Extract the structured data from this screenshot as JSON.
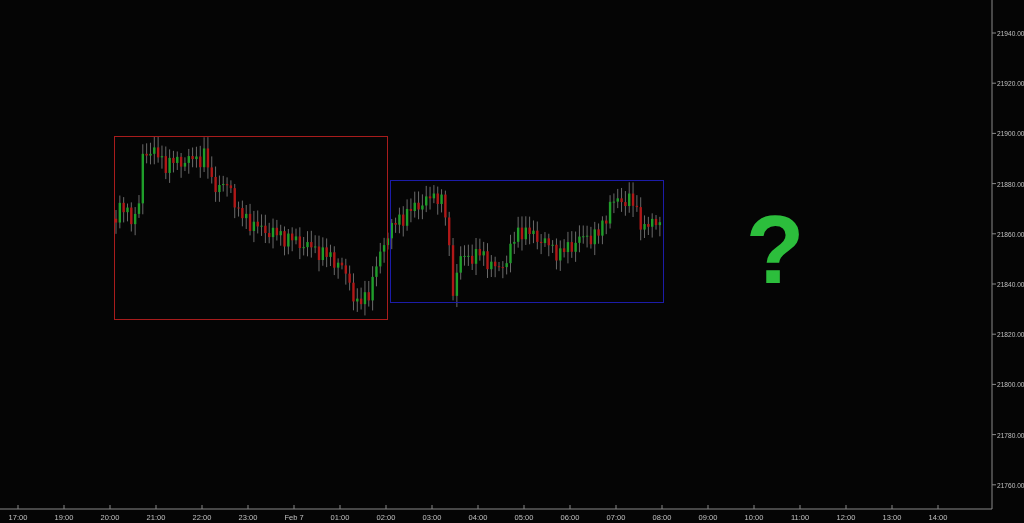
{
  "chart": {
    "y_axis_labels": [
      "21940.00",
      "21920.00",
      "21900.00",
      "21880.00",
      "21860.00",
      "21840.00",
      "21820.00",
      "21800.00",
      "21780.00",
      "21760.00"
    ],
    "x_axis_labels": [
      "17:00",
      "19:00",
      "20:00",
      "21:00",
      "22:00",
      "23:00",
      "Feb 7",
      "01:00",
      "02:00",
      "03:00",
      "04:00",
      "05:00",
      "06:00",
      "07:00",
      "08:00",
      "09:00",
      "10:00",
      "11:00",
      "12:00",
      "13:00",
      "14:00"
    ],
    "regions": [
      {
        "kind": "range-box",
        "color": "#a81c1c"
      },
      {
        "kind": "range-box",
        "color": "#1c1ca8"
      }
    ],
    "annotation": "?"
  }
}
